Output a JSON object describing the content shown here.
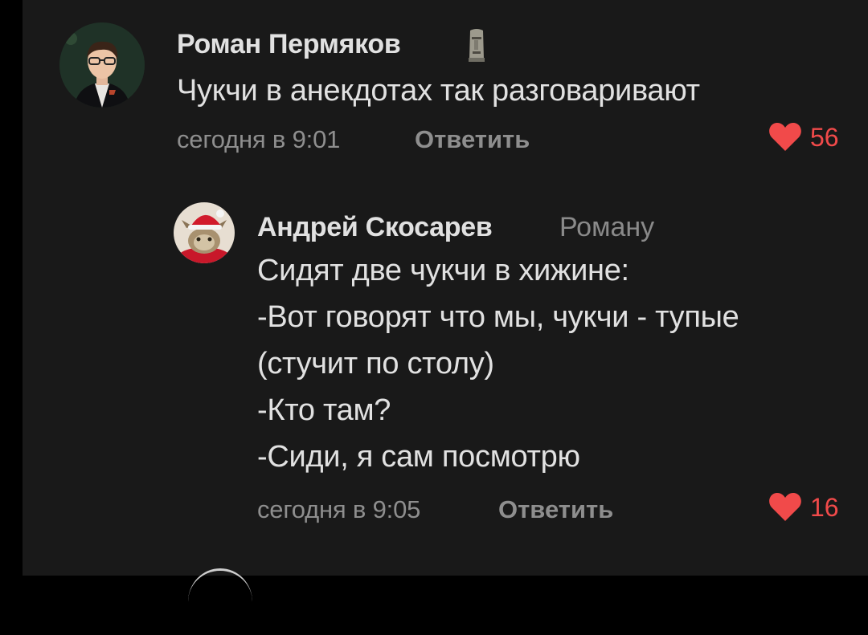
{
  "comments": [
    {
      "author": "Роман Пермяков",
      "author_badge_icon": "moai-emoji-icon",
      "text_lines": [
        "Чукчи в анекдотах так разговаривают"
      ],
      "timestamp": "сегодня в 9:01",
      "reply_label": "Ответить",
      "likes": "56",
      "liked": true
    },
    {
      "author": "Андрей Скосарев",
      "reply_to": "Роману",
      "text_lines": [
        "Сидят две чукчи в хижине:",
        "-Вот говорят что мы, чукчи - тупые",
        "(стучит по столу)",
        "-Кто там?",
        "-Сиди, я сам посмотрю"
      ],
      "timestamp": "сегодня в 9:05",
      "reply_label": "Ответить",
      "likes": "16",
      "liked": true
    }
  ],
  "colors": {
    "background": "#191919",
    "like_red": "#f14a4a",
    "text": "#e1e1e1",
    "muted": "#8e8e8e"
  }
}
